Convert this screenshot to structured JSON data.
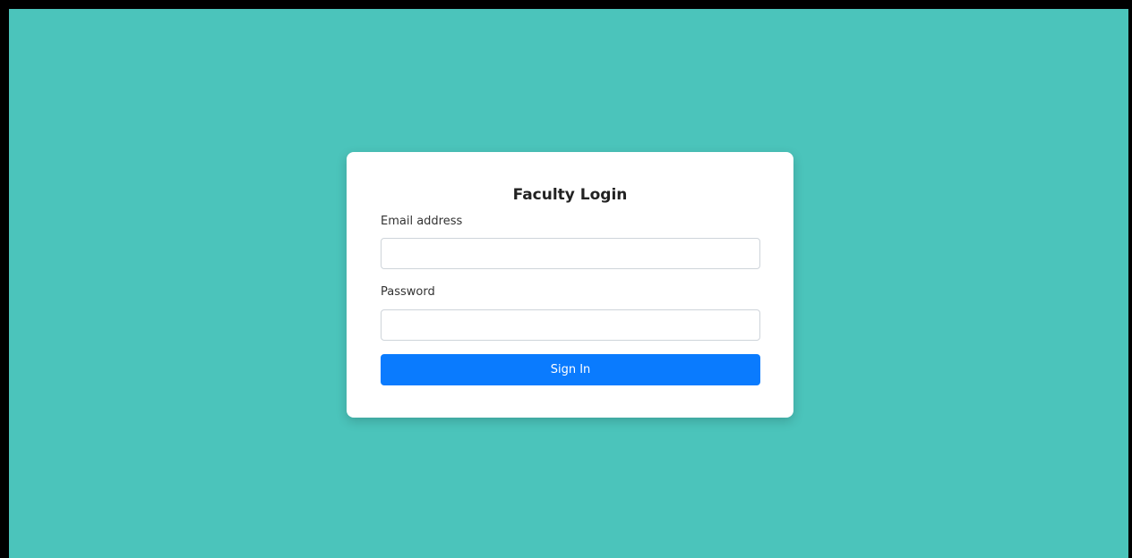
{
  "colors": {
    "background": "#4bc4bb",
    "card": "#ffffff",
    "primary": "#0a7bfe"
  },
  "login": {
    "title": "Faculty Login",
    "email_label": "Email address",
    "email_value": "",
    "password_label": "Password",
    "password_value": "",
    "submit_label": "Sign In"
  }
}
